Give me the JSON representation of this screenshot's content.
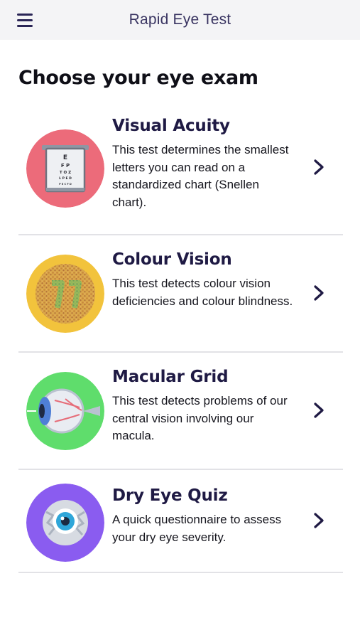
{
  "header": {
    "title": "Rapid Eye Test"
  },
  "page_title": "Choose your eye exam",
  "exams": [
    {
      "title": "Visual Acuity",
      "description": "This test determines the smallest letters you can read on a standardized chart (Snellen chart).",
      "icon": "eye-chart-icon",
      "color": "#ec6b7a"
    },
    {
      "title": "Colour Vision",
      "description": "This test detects colour vision deficiencies and colour blindness.",
      "icon": "color-plate-icon",
      "color": "#f2c33c"
    },
    {
      "title": "Macular Grid",
      "description": "This test detects problems of our central vision involving our macula.",
      "icon": "eye-anatomy-icon",
      "color": "#5fdd6c"
    },
    {
      "title": "Dry Eye Quiz",
      "description": "A quick questionnaire to assess your dry eye severity.",
      "icon": "dry-eye-icon",
      "color": "#8a5cf0"
    }
  ],
  "eye_chart_letters": [
    "E",
    "F P",
    "T O Z",
    "L P E D",
    "P E C F D"
  ]
}
